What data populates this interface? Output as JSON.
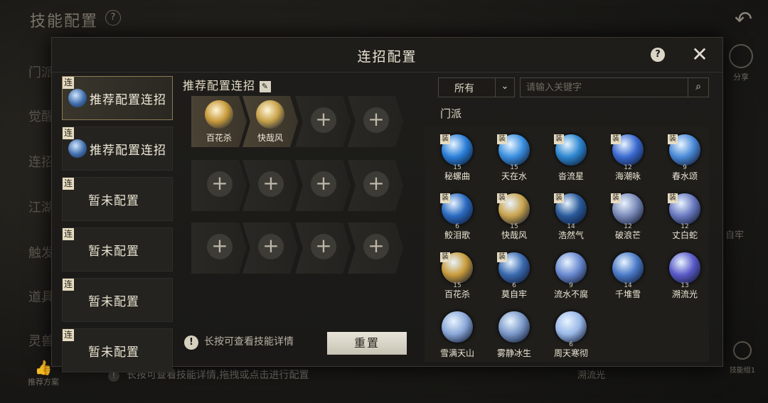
{
  "background": {
    "title": "技能配置",
    "help": "?",
    "side_items": [
      "门派",
      "觉醒",
      "连招",
      "江湖",
      "触发",
      "道具",
      "灵兽"
    ],
    "share_label": "分享",
    "recommend_label": "推荐方案",
    "hint": "长按可查看技能详情,拖拽或点击进行配置",
    "combo_group_label": "技能组1",
    "right_label_1": "自牢",
    "right_label_2": "溯流光"
  },
  "modal": {
    "title": "连招配置",
    "help": "?",
    "close": "✕"
  },
  "combo_list": [
    {
      "tag": "连",
      "label": "推荐配置连招",
      "active": true,
      "has_icon": true
    },
    {
      "tag": "连",
      "label": "推荐配置连招",
      "active": false,
      "has_icon": true
    },
    {
      "tag": "连",
      "label": "暂未配置",
      "active": false,
      "has_icon": false
    },
    {
      "tag": "连",
      "label": "暂未配置",
      "active": false,
      "has_icon": false
    },
    {
      "tag": "连",
      "label": "暂未配置",
      "active": false,
      "has_icon": false
    },
    {
      "tag": "连",
      "label": "暂未配置",
      "active": false,
      "has_icon": false
    }
  ],
  "editor": {
    "title": "推荐配置连招",
    "edit_icon": "✎",
    "plus": "+",
    "rows": [
      [
        {
          "name": "百花杀",
          "filled": true
        },
        {
          "name": "快哉风",
          "filled": true
        },
        {
          "filled": false
        },
        {
          "filled": false
        }
      ],
      [
        {
          "filled": false
        },
        {
          "filled": false
        },
        {
          "filled": false
        },
        {
          "filled": false
        }
      ],
      [
        {
          "filled": false
        },
        {
          "filled": false
        },
        {
          "filled": false
        },
        {
          "filled": false
        }
      ]
    ],
    "hint": "长按可查看技能详情",
    "reset_label": "重置"
  },
  "filter": {
    "select_value": "所有",
    "search_placeholder": "请输入关键字",
    "section_title": "门派"
  },
  "skills": [
    {
      "name": "秘螺曲",
      "tag": "装",
      "level": "15",
      "color": "#2a7fd8"
    },
    {
      "name": "天在水",
      "tag": "装",
      "level": "15",
      "color": "#3a8fe0"
    },
    {
      "name": "沓流星",
      "tag": "装",
      "level": "",
      "color": "#2c86d0"
    },
    {
      "name": "海潮咏",
      "tag": "装",
      "level": "12",
      "color": "#3a6ad0"
    },
    {
      "name": "春水颂",
      "tag": "装",
      "level": "9",
      "color": "#4a8ad8"
    },
    {
      "name": "鲛泪歌",
      "tag": "装",
      "level": "6",
      "color": "#2a6ac0"
    },
    {
      "name": "快哉风",
      "tag": "装",
      "level": "15",
      "color": "#c8a24a"
    },
    {
      "name": "浩然气",
      "tag": "装",
      "level": "14",
      "color": "#2a5a9a"
    },
    {
      "name": "破浪芒",
      "tag": "装",
      "level": "12",
      "color": "#7a8ab8"
    },
    {
      "name": "丈白蛇",
      "tag": "装",
      "level": "12",
      "color": "#6a7ac0"
    },
    {
      "name": "百花杀",
      "tag": "装",
      "level": "15",
      "color": "#c89a3a"
    },
    {
      "name": "莫自牢",
      "tag": "装",
      "level": "6",
      "color": "#3a6ab0"
    },
    {
      "name": "流水不腐",
      "tag": "",
      "level": "9",
      "color": "#6a8ad0"
    },
    {
      "name": "千堆雪",
      "tag": "",
      "level": "14",
      "color": "#4a7ac8"
    },
    {
      "name": "溯流光",
      "tag": "",
      "level": "13",
      "color": "#5a5ac8"
    },
    {
      "name": "雪满天山",
      "tag": "",
      "level": "",
      "color": "#8aa8d8"
    },
    {
      "name": "雾静冰生",
      "tag": "",
      "level": "",
      "color": "#7a98c8"
    },
    {
      "name": "周天寒彻",
      "tag": "",
      "level": "6",
      "color": "#9ab8e8"
    }
  ]
}
